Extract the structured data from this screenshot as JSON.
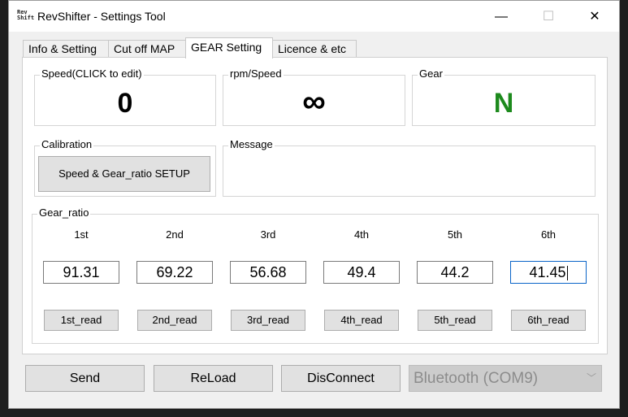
{
  "window": {
    "app_icon_text": "Rev\nShift",
    "title": "RevShifter - Settings Tool",
    "minimize": "—",
    "maximize": "☐",
    "close": "✕"
  },
  "tabs": [
    {
      "label": "Info & Setting",
      "active": false
    },
    {
      "label": "Cut off MAP",
      "active": false
    },
    {
      "label": "GEAR Setting",
      "active": true
    },
    {
      "label": "Licence & etc",
      "active": false
    }
  ],
  "speed": {
    "label": "Speed(CLICK to edit)",
    "value": "0"
  },
  "rpm_speed": {
    "label": "rpm/Speed",
    "value": "∞"
  },
  "gear": {
    "label": "Gear",
    "value": "N"
  },
  "calibration": {
    "label": "Calibration",
    "button": "Speed & Gear_ratio SETUP"
  },
  "message": {
    "label": "Message",
    "text": ""
  },
  "gear_ratio": {
    "label": "Gear_ratio",
    "columns": [
      {
        "head": "1st",
        "value": "91.31",
        "read": "1st_read"
      },
      {
        "head": "2nd",
        "value": "69.22",
        "read": "2nd_read"
      },
      {
        "head": "3rd",
        "value": "56.68",
        "read": "3rd_read"
      },
      {
        "head": "4th",
        "value": "49.4",
        "read": "4th_read"
      },
      {
        "head": "5th",
        "value": "44.2",
        "read": "5th_read"
      },
      {
        "head": "6th",
        "value": "41.45",
        "read": "6th_read"
      }
    ]
  },
  "buttons": {
    "send": "Send",
    "reload": "ReLoad",
    "disconnect": "DisConnect"
  },
  "port": {
    "selected": "Bluetooth (COM9)",
    "arrow": "﹀"
  },
  "colors": {
    "gear_neutral": "#1d8a1d",
    "focus_border": "#0a64c8"
  }
}
